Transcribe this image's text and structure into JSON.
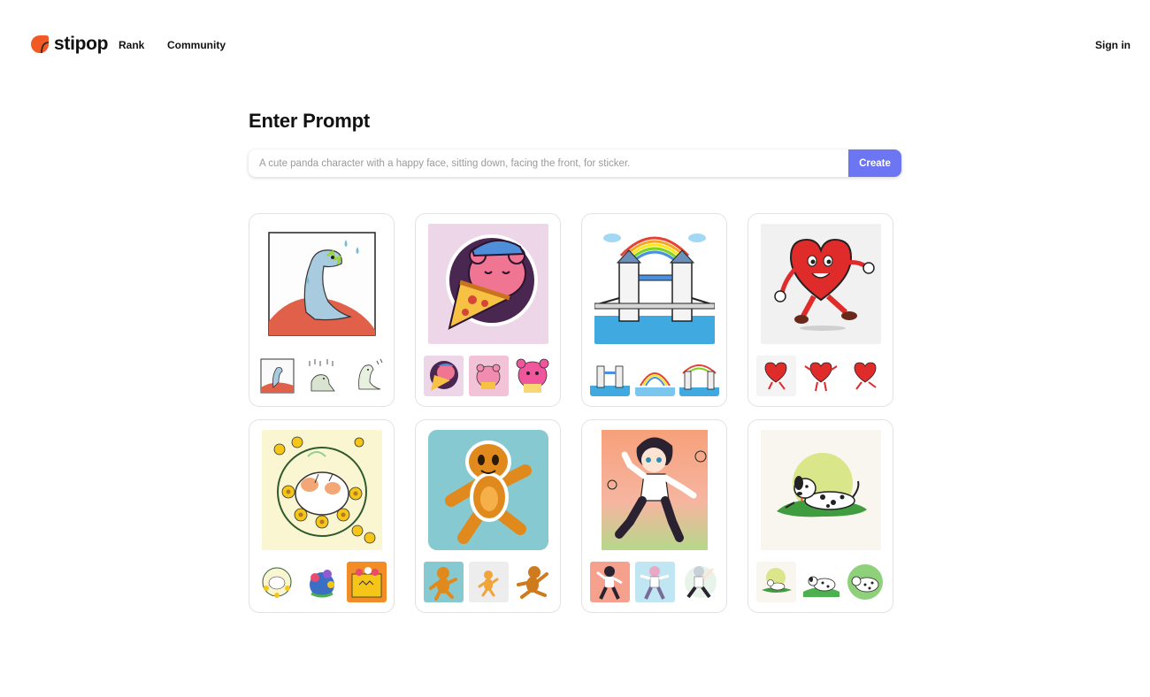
{
  "header": {
    "brand": "stipop",
    "nav": [
      {
        "label": "Rank"
      },
      {
        "label": "Community"
      }
    ],
    "sign_in": "Sign in"
  },
  "prompt": {
    "title": "Enter Prompt",
    "placeholder": "A cute panda character with a happy face, sitting down, facing the front, for sticker.",
    "value": "",
    "create_label": "Create"
  },
  "colors": {
    "brand": "#f15a24",
    "accent": "#6c75f2"
  },
  "gallery": [
    {
      "name": "dinosaur-sticker",
      "thumbs": [
        "dinosaur-thumb",
        "dinosaur-rain-thumb",
        "dinosaur-sketch-thumb"
      ]
    },
    {
      "name": "bear-pizza-sticker",
      "thumbs": [
        "bear-pizza-thumb",
        "pink-bear-thumb",
        "pink-bear-cake-thumb"
      ]
    },
    {
      "name": "tower-bridge-sticker",
      "thumbs": [
        "bridge-thumb",
        "rainbow-arch-thumb",
        "bridge-rainbow-thumb"
      ]
    },
    {
      "name": "heart-character-sticker",
      "thumbs": [
        "heart-walk-thumb",
        "heart-dance-thumb",
        "heart-run-thumb"
      ]
    },
    {
      "name": "flower-cat-sticker",
      "thumbs": [
        "flower-cat-thumb",
        "flower-planet-thumb",
        "flower-box-thumb"
      ]
    },
    {
      "name": "gingerbread-sticker",
      "thumbs": [
        "gingerbread-teal-thumb",
        "gingerbread-small-thumb",
        "gingerbread-run-thumb"
      ]
    },
    {
      "name": "dancer-sticker",
      "thumbs": [
        "dancer-red-thumb",
        "dancer-blue-thumb",
        "dancer-white-thumb"
      ]
    },
    {
      "name": "dalmatian-sticker",
      "thumbs": [
        "dalmatian-sun-thumb",
        "dalmatian-grass-thumb",
        "dalmatian-green-thumb"
      ]
    }
  ]
}
